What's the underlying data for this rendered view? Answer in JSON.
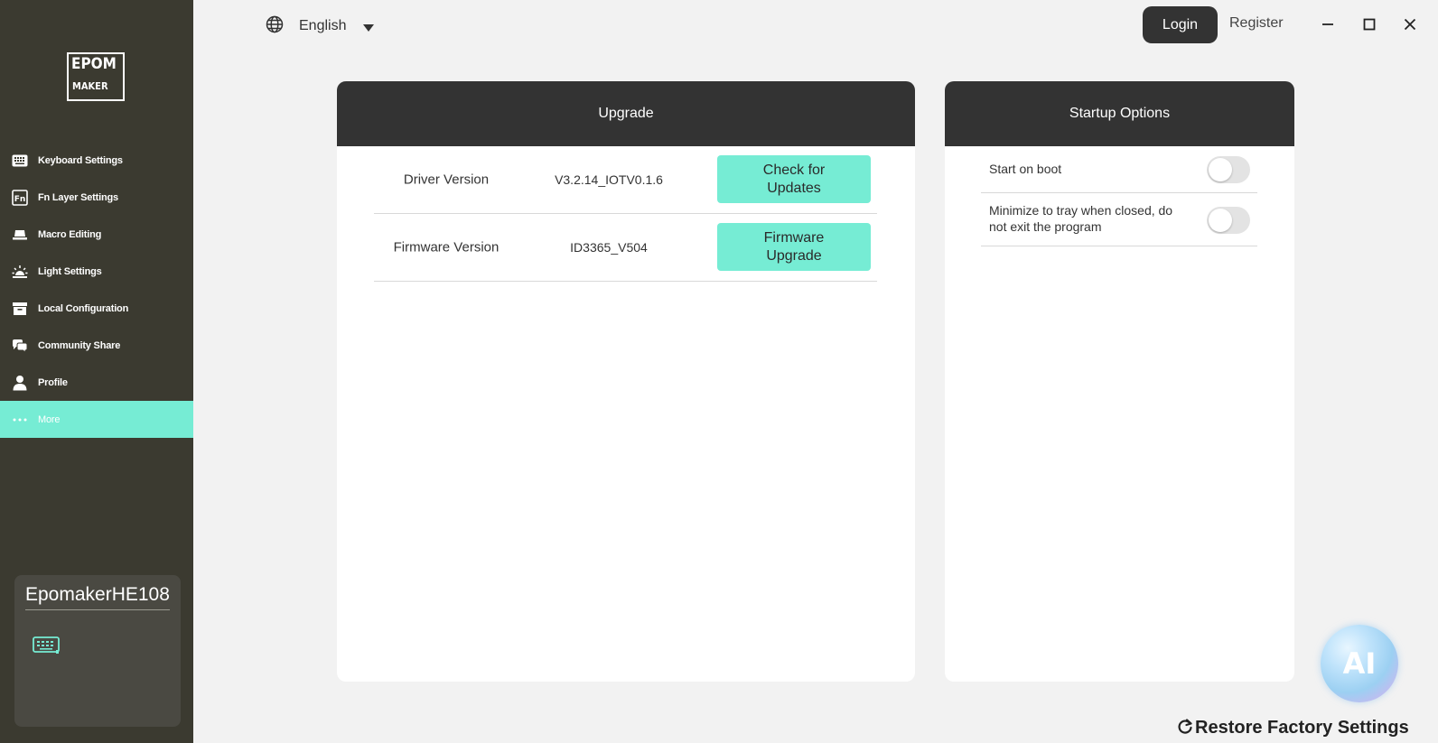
{
  "sidebar": {
    "logo": {
      "line1": "EPOM",
      "line2": "MAKER"
    },
    "items": [
      {
        "label": "Keyboard Settings",
        "icon": "keyboard-icon",
        "active": false
      },
      {
        "label": "Fn Layer Settings",
        "icon": "fn-icon",
        "active": false
      },
      {
        "label": "Macro Editing",
        "icon": "macro-icon",
        "active": false
      },
      {
        "label": "Light Settings",
        "icon": "light-icon",
        "active": false
      },
      {
        "label": "Local Configuration",
        "icon": "archive-icon",
        "active": false
      },
      {
        "label": "Community Share",
        "icon": "chat-icon",
        "active": false
      },
      {
        "label": "Profile",
        "icon": "user-icon",
        "active": false
      },
      {
        "label": "More",
        "icon": "more-dots-icon",
        "active": true
      }
    ],
    "device": {
      "name": "EpomakerHE108",
      "icon": "keyboard-icon"
    }
  },
  "topbar": {
    "language": "English",
    "login_label": "Login",
    "register_label": "Register"
  },
  "upgrade": {
    "title": "Upgrade",
    "rows": [
      {
        "label": "Driver Version",
        "value": "V3.2.14_IOTV0.1.6",
        "button": "Check for Updates"
      },
      {
        "label": "Firmware Version",
        "value": "ID3365_V504",
        "button": "Firmware Upgrade"
      }
    ]
  },
  "startup": {
    "title": "Startup Options",
    "options": [
      {
        "label": "Start on boot",
        "enabled": false
      },
      {
        "label": "Minimize to tray when closed, do not exit the program",
        "enabled": false
      }
    ]
  },
  "ai_badge": "AI",
  "restore_label": "Restore Factory Settings",
  "colors": {
    "sidebar": "#3b3a30",
    "accent": "#76ecd4",
    "header": "#333333",
    "background": "#f2f2f2"
  }
}
